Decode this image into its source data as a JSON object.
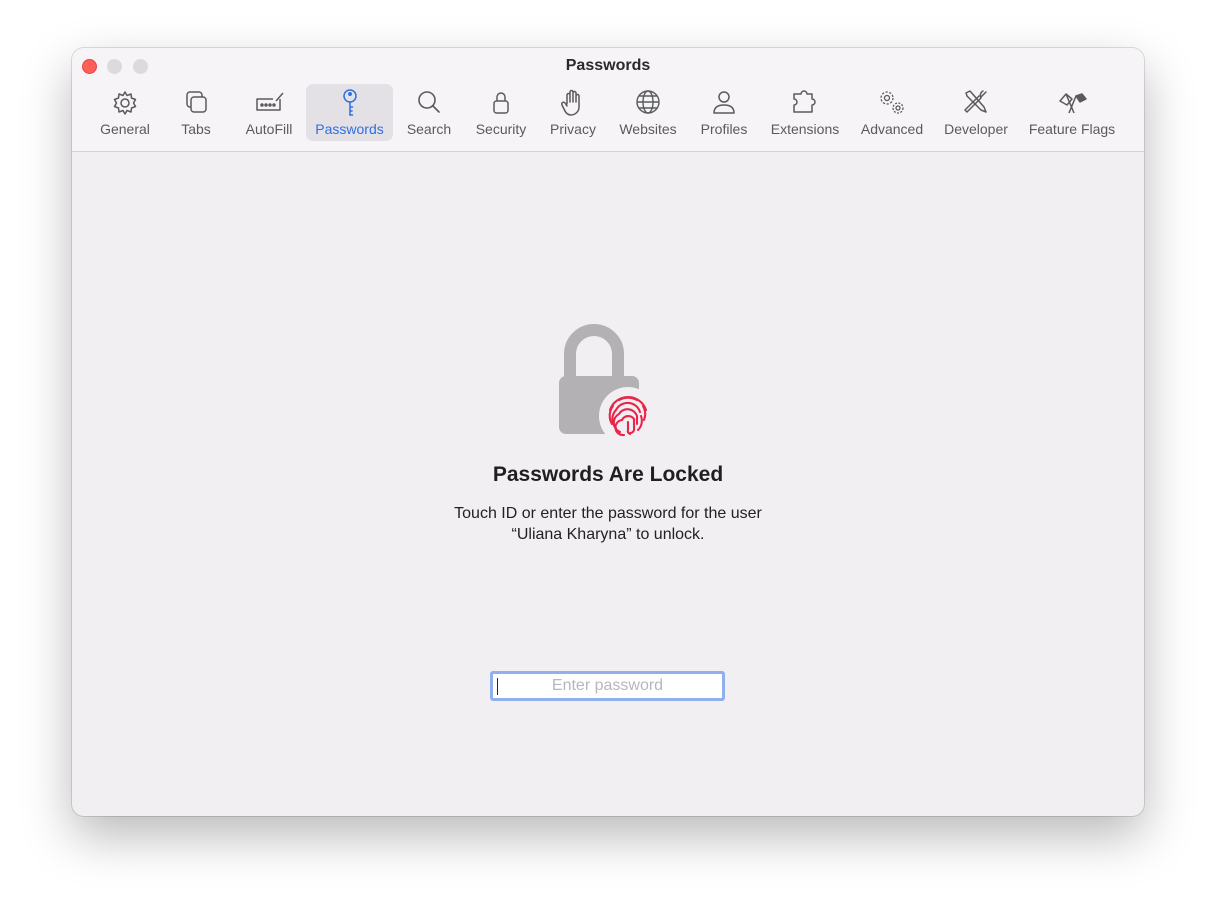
{
  "window": {
    "title": "Passwords"
  },
  "toolbar": {
    "items": [
      {
        "label": "General",
        "icon": "gear-icon"
      },
      {
        "label": "Tabs",
        "icon": "tabs-icon"
      },
      {
        "label": "AutoFill",
        "icon": "autofill-icon"
      },
      {
        "label": "Passwords",
        "icon": "key-icon",
        "active": true
      },
      {
        "label": "Search",
        "icon": "magnifier-icon"
      },
      {
        "label": "Security",
        "icon": "lock-icon"
      },
      {
        "label": "Privacy",
        "icon": "hand-icon"
      },
      {
        "label": "Websites",
        "icon": "globe-icon"
      },
      {
        "label": "Profiles",
        "icon": "person-icon"
      },
      {
        "label": "Extensions",
        "icon": "puzzle-icon"
      },
      {
        "label": "Advanced",
        "icon": "gears-icon"
      },
      {
        "label": "Developer",
        "icon": "tools-icon"
      },
      {
        "label": "Feature Flags",
        "icon": "flags-icon"
      }
    ]
  },
  "locked": {
    "heading": "Passwords Are Locked",
    "line1": "Touch ID or enter the password for the user",
    "line2": "“Uliana Kharyna” to unlock.",
    "input_placeholder": "Enter password",
    "input_value": ""
  },
  "colors": {
    "accent": "#2f6fde",
    "close": "#fe5f57",
    "fingerprint": "#e8264a",
    "lock": "#b3b1b4",
    "focus_ring": "#8fb0ec"
  }
}
